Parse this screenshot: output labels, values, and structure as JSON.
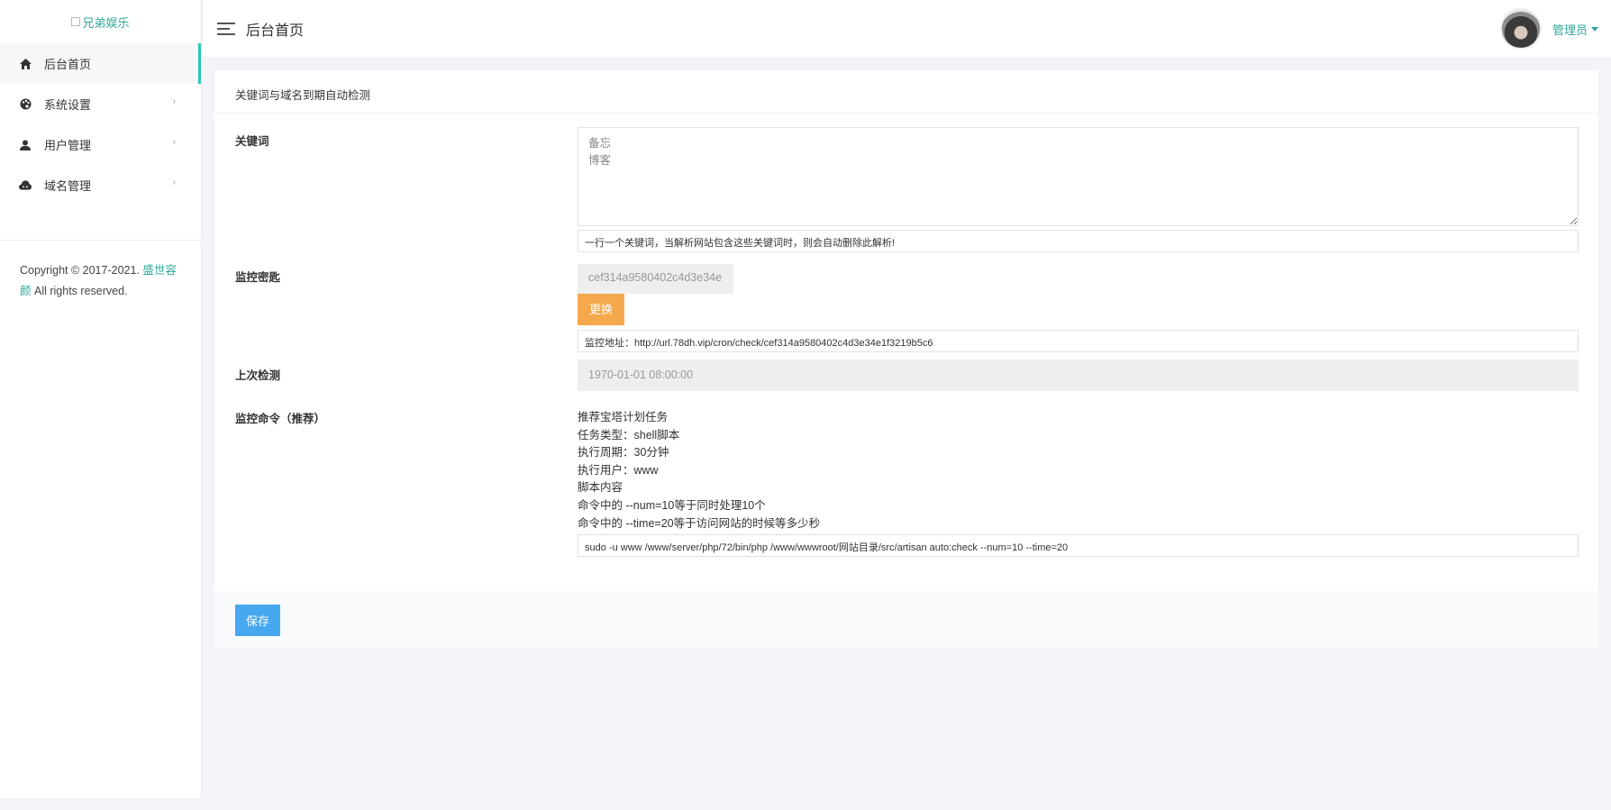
{
  "brand": {
    "logo_alt": "兄弟娱乐"
  },
  "sidebar": {
    "items": [
      {
        "label": "后台首页",
        "icon": "home-icon",
        "active": true
      },
      {
        "label": "系统设置",
        "icon": "palette-icon",
        "arrow": "›"
      },
      {
        "label": "用户管理",
        "icon": "user-icon",
        "arrow": "›"
      },
      {
        "label": "域名管理",
        "icon": "cloud-icon",
        "arrow": "›"
      }
    ],
    "copyright_prefix": "Copyright © 2017-2021.",
    "copyright_link": "盛世容颜",
    "copyright_suffix": "All rights reserved."
  },
  "header": {
    "title": "后台首页",
    "user_name": "管理员"
  },
  "card": {
    "title": "关键词与域名到期自动检测",
    "keywords": {
      "label": "关键词",
      "value": "备忘\n博客",
      "help": "一行一个关键词，当解析网站包含这些关键词时，则会自动删除此解析!"
    },
    "monitor_key": {
      "label": "监控密匙",
      "value": "cef314a9580402c4d3e34e",
      "change_button": "更换",
      "url": "监控地址：http://url.78dh.vip/cron/check/cef314a9580402c4d3e34e1f3219b5c6"
    },
    "last_check": {
      "label": "上次检测",
      "value": "1970-01-01 08:00:00"
    },
    "command": {
      "label": "监控命令（推荐）",
      "lines": [
        "推荐宝塔计划任务",
        "任务类型：shell脚本",
        "执行周期：30分钟",
        "执行用户：www",
        "脚本内容",
        "命令中的 --num=10等于同时处理10个",
        "命令中的 --time=20等于访问网站的时候等多少秒"
      ],
      "value": "sudo -u www /www/server/php/72/bin/php /www/wwwroot/网站目录/src/artisan auto:check --num=10 --time=20"
    },
    "save_button": "保存"
  },
  "colors": {
    "accent": "#2ea89b",
    "warning": "#f5a94c",
    "primary": "#47a8ef"
  }
}
